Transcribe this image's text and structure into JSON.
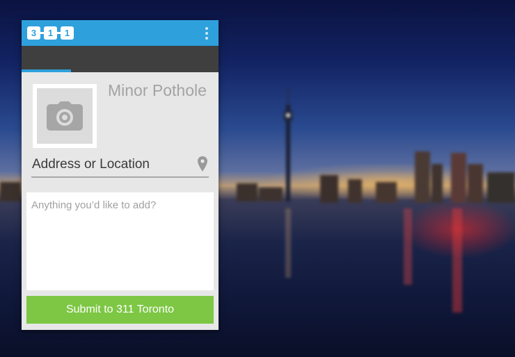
{
  "app": {
    "logo_digits": [
      "3",
      "1",
      "1"
    ],
    "menu_icon": "kebab-menu-icon"
  },
  "form": {
    "photo_icon": "camera-icon",
    "title": "Minor Pothole",
    "address": {
      "value": "Address or Location",
      "icon": "location-pin-icon"
    },
    "notes": {
      "placeholder": "Anything you’d like to add?"
    },
    "submit_label": "Submit to 311 Toronto"
  },
  "colors": {
    "brand_blue": "#2ea0dc",
    "submit_green": "#7dc744",
    "tab_bar": "#3f3f3f"
  }
}
